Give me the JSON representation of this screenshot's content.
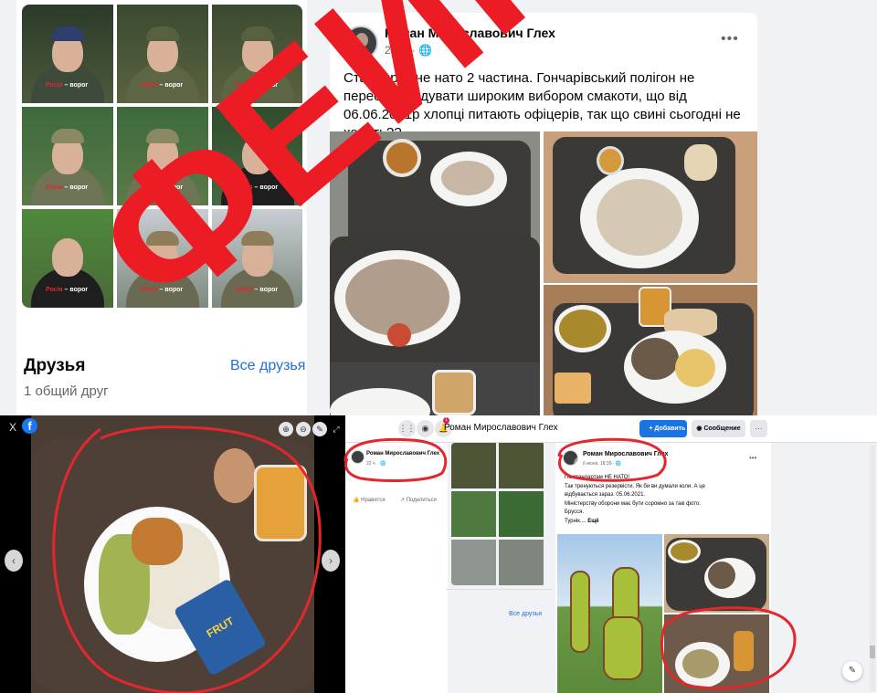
{
  "stamp": {
    "text": "ФЕЙК",
    "color": "#ec1c24"
  },
  "profile": {
    "photo_tag": {
      "prefix": "Росія",
      "suffix": " – ворог"
    },
    "friends": {
      "title": "Друзья",
      "all_link": "Все друзья",
      "mutual": "1 общий друг"
    }
  },
  "post": {
    "author": "Роман Мирославович Глех",
    "time": "23 ч.",
    "privacy_icon": "globe-icon",
    "more_icon": "more-dots-icon",
    "text": "Стандарти не нато 2 частина. Гончарівський полігон не перестає радувати широким вибором смакоти, що від 06.06.2021р хлопці питають офіцерів, так що свині сьогодні не ходять??"
  },
  "viewer": {
    "close_label": "X",
    "facebook_icon": "f",
    "prev_icon": "‹",
    "next_icon": "›",
    "zoom_in_icon": "⊕",
    "zoom_out_icon": "⊖",
    "tag_icon": "tag-icon",
    "fullscreen_icon": "⤢",
    "juice_label": "FRUT"
  },
  "desktop": {
    "header_title": "Роман Мирославович Глех",
    "notification_count": "1",
    "add_button": "Добавить",
    "message_button": "Сообщение",
    "more_button": "···",
    "mini_card": {
      "author": "Роман Мирославович Глех",
      "time": "22 ч.",
      "like": "Нравится",
      "share": "Поделиться"
    },
    "all_friends": "Все друзья",
    "mini_post": {
      "author": "Роман Мирославович Глех",
      "time": "6 июня, 18:39",
      "lines": [
        "По стандартам НЕ НАТО!",
        "Так тренуються резервісти. Як би ви думали коли. А це",
        "відбувається зараз. 05.06.2021.",
        "Міністерству оборони має бути соромно за такі фото.",
        "Брусся.",
        "Турнік...."
      ],
      "more_link": "Ещё"
    }
  }
}
